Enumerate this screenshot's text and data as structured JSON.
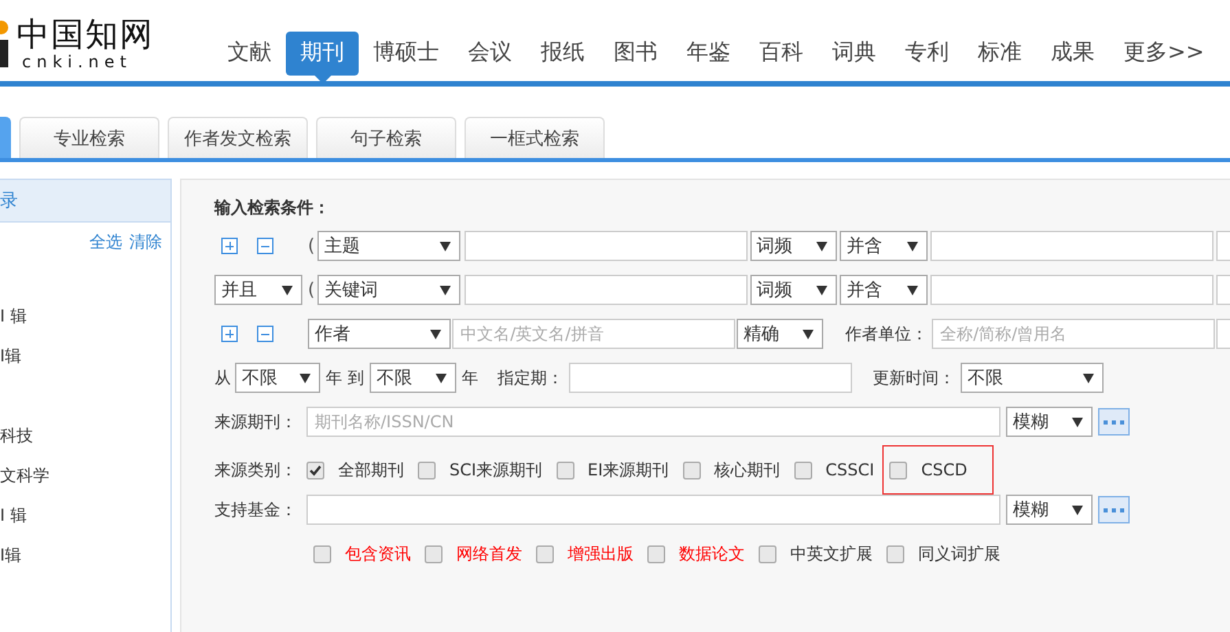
{
  "logo": {
    "name": "中国知网",
    "domain": "cnki.net"
  },
  "nav": [
    {
      "label": "文献",
      "selected": false
    },
    {
      "label": "期刊",
      "selected": true
    },
    {
      "label": "博硕士",
      "selected": false
    },
    {
      "label": "会议",
      "selected": false
    },
    {
      "label": "报纸",
      "selected": false
    },
    {
      "label": "图书",
      "selected": false
    },
    {
      "label": "年鉴",
      "selected": false
    },
    {
      "label": "百科",
      "selected": false
    },
    {
      "label": "词典",
      "selected": false
    },
    {
      "label": "专利",
      "selected": false
    },
    {
      "label": "标准",
      "selected": false
    },
    {
      "label": "成果",
      "selected": false
    },
    {
      "label": "更多>>",
      "selected": false
    }
  ],
  "tabs": [
    {
      "selected": true
    },
    {
      "label": "专业检索",
      "selected": false
    },
    {
      "label": "作者发文检索",
      "selected": false
    },
    {
      "label": "句子检索",
      "selected": false
    },
    {
      "label": "一框式检索",
      "selected": false
    }
  ],
  "sidebar": {
    "header": "录",
    "actions": [
      "全选",
      "清除"
    ],
    "items": [
      "I 辑",
      "I辑",
      "科技",
      "文科学",
      "I 辑",
      "I辑"
    ]
  },
  "form": {
    "title": "输入检索条件：",
    "subject_rows": [
      {
        "open_paren": "(",
        "field": "主题",
        "frequency": "词频",
        "combine": "并含"
      },
      {
        "logic": "并且",
        "open_paren": "(",
        "field": "关键词",
        "frequency": "词频",
        "combine": "并含"
      }
    ],
    "author_row": {
      "field": "作者",
      "placeholder": "中文名/英文名/拼音",
      "match": "精确",
      "org_label": "作者单位：",
      "org_placeholder": "全称/简称/曾用名"
    },
    "date_row": {
      "from_label": "从",
      "from": "不限",
      "to_label": "年 到",
      "to": "不限",
      "year_label": "年",
      "period_label": "指定期：",
      "update_label": "更新时间：",
      "update": "不限"
    },
    "source": {
      "label": "来源期刊：",
      "placeholder": "期刊名称/ISSN/CN",
      "match": "模糊"
    },
    "category": {
      "label": "来源类别：",
      "options": [
        {
          "label": "全部期刊",
          "checked": true,
          "highlighted": false
        },
        {
          "label": "SCI来源期刊",
          "checked": false,
          "highlighted": false
        },
        {
          "label": "EI来源期刊",
          "checked": false,
          "highlighted": false
        },
        {
          "label": "核心期刊",
          "checked": false,
          "highlighted": false
        },
        {
          "label": "CSSCI",
          "checked": false,
          "highlighted": false
        },
        {
          "label": "CSCD",
          "checked": false,
          "highlighted": true
        }
      ]
    },
    "fund": {
      "label": "支持基金：",
      "match": "模糊"
    },
    "extras": [
      {
        "label": "包含资讯",
        "checked": false,
        "color": "#ff0000"
      },
      {
        "label": "网络首发",
        "checked": false,
        "color": "#ff0000"
      },
      {
        "label": "增强出版",
        "checked": false,
        "color": "#ff0000"
      },
      {
        "label": "数据论文",
        "checked": false,
        "color": "#ff0000"
      },
      {
        "label": "中英文扩展",
        "checked": false,
        "color": "#333333"
      },
      {
        "label": "同义词扩展",
        "checked": false,
        "color": "#333333"
      }
    ]
  }
}
